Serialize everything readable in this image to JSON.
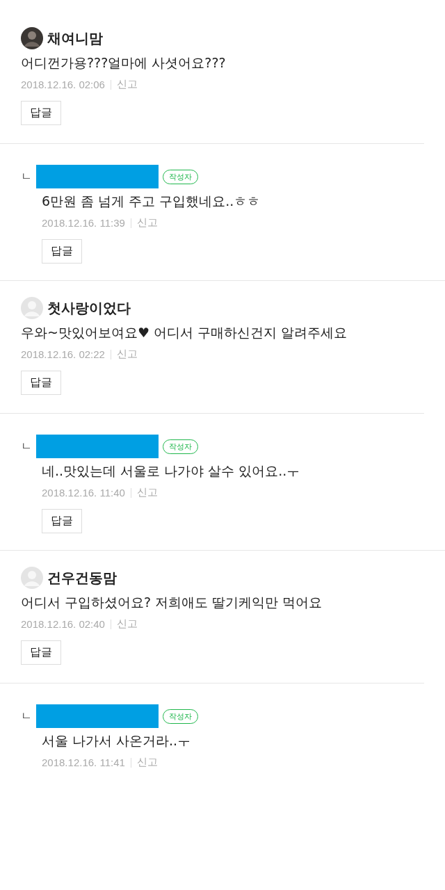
{
  "threads": [
    {
      "author": {
        "name": "채여니맘",
        "avatar": {
          "kind": "photo"
        }
      },
      "text": "어디껀가용???얼마에 사셧어요???",
      "date": "2018.12.16. 02:06",
      "report": "신고",
      "reply_button": "답글",
      "replies": [
        {
          "branch": "ㄴ",
          "badge": "작성자",
          "text": "6만원 좀 넘게 주고 구입했네요..ㅎㅎ",
          "date": "2018.12.16. 11:39",
          "report": "신고",
          "reply_button": "답글"
        }
      ]
    },
    {
      "author": {
        "name": "첫사랑이었다",
        "avatar": {
          "kind": "default"
        }
      },
      "text": "우와~맛있어보여요♥ 어디서 구매하신건지 알려주세요",
      "date": "2018.12.16. 02:22",
      "report": "신고",
      "reply_button": "답글",
      "replies": [
        {
          "branch": "ㄴ",
          "badge": "작성자",
          "text": "네..맛있는데 서울로 나가야 살수 있어요..ㅜ",
          "date": "2018.12.16. 11:40",
          "report": "신고",
          "reply_button": "답글"
        }
      ]
    },
    {
      "author": {
        "name": "건우건동맘",
        "avatar": {
          "kind": "default"
        }
      },
      "text": "어디서 구입하셨어요? 저희애도 딸기케익만 먹어요",
      "date": "2018.12.16. 02:40",
      "report": "신고",
      "reply_button": "답글",
      "replies": [
        {
          "branch": "ㄴ",
          "badge": "작성자",
          "text": "서울 나가서 사온거라..ㅜ",
          "date": "2018.12.16. 11:41",
          "report": "신고"
        }
      ]
    }
  ]
}
